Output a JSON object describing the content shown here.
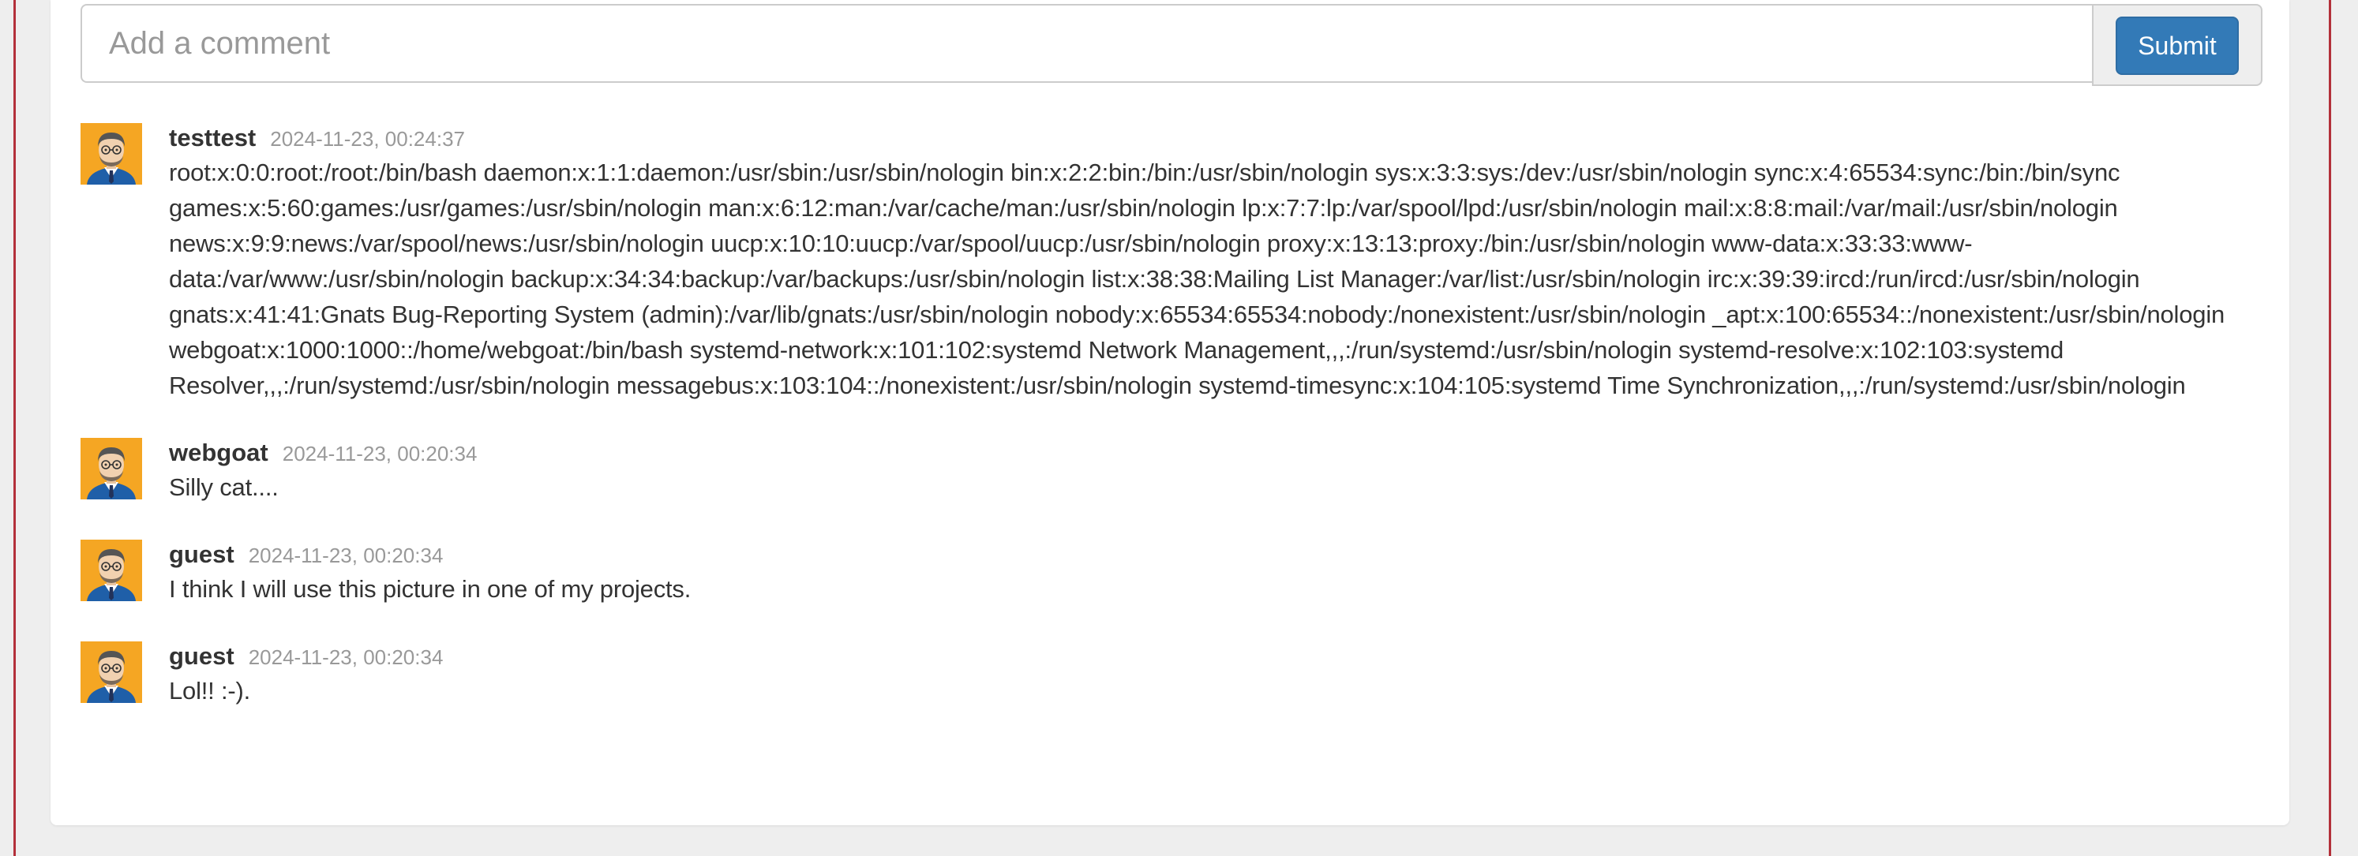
{
  "comment_form": {
    "placeholder": "Add a comment",
    "submit_label": "Submit"
  },
  "comments": [
    {
      "user": "testtest",
      "date": "2024-11-23, 00:24:37",
      "text": "root:x:0:0:root:/root:/bin/bash daemon:x:1:1:daemon:/usr/sbin:/usr/sbin/nologin bin:x:2:2:bin:/bin:/usr/sbin/nologin sys:x:3:3:sys:/dev:/usr/sbin/nologin sync:x:4:65534:sync:/bin:/bin/sync games:x:5:60:games:/usr/games:/usr/sbin/nologin man:x:6:12:man:/var/cache/man:/usr/sbin/nologin lp:x:7:7:lp:/var/spool/lpd:/usr/sbin/nologin mail:x:8:8:mail:/var/mail:/usr/sbin/nologin news:x:9:9:news:/var/spool/news:/usr/sbin/nologin uucp:x:10:10:uucp:/var/spool/uucp:/usr/sbin/nologin proxy:x:13:13:proxy:/bin:/usr/sbin/nologin www-data:x:33:33:www-data:/var/www:/usr/sbin/nologin backup:x:34:34:backup:/var/backups:/usr/sbin/nologin list:x:38:38:Mailing List Manager:/var/list:/usr/sbin/nologin irc:x:39:39:ircd:/run/ircd:/usr/sbin/nologin gnats:x:41:41:Gnats Bug-Reporting System (admin):/var/lib/gnats:/usr/sbin/nologin nobody:x:65534:65534:nobody:/nonexistent:/usr/sbin/nologin _apt:x:100:65534::/nonexistent:/usr/sbin/nologin webgoat:x:1000:1000::/home/webgoat:/bin/bash systemd-network:x:101:102:systemd Network Management,,,:/run/systemd:/usr/sbin/nologin systemd-resolve:x:102:103:systemd Resolver,,,:/run/systemd:/usr/sbin/nologin messagebus:x:103:104::/nonexistent:/usr/sbin/nologin systemd-timesync:x:104:105:systemd Time Synchronization,,,:/run/systemd:/usr/sbin/nologin"
    },
    {
      "user": "webgoat",
      "date": "2024-11-23, 00:20:34",
      "text": "Silly cat...."
    },
    {
      "user": "guest",
      "date": "2024-11-23, 00:20:34",
      "text": "I think I will use this picture in one of my projects."
    },
    {
      "user": "guest",
      "date": "2024-11-23, 00:20:34",
      "text": "Lol!! :-)."
    }
  ],
  "icons": {
    "avatar": "user-avatar-icon"
  },
  "colors": {
    "accent": "#337ab7",
    "frame_line": "#b3303a",
    "avatar_bg": "#f5a623"
  }
}
